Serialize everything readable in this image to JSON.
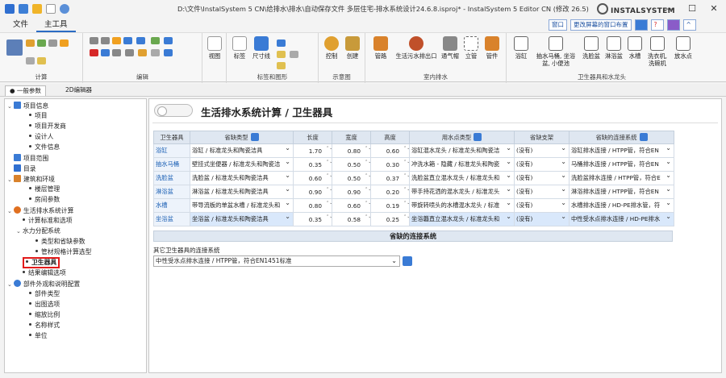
{
  "window": {
    "title": "D:\\文件\\InstalSystem 5 CN\\给排水\\排水\\自动保存文件 多层住宅-排水系统设计24.6.8.isproj* - InstalSystem 5 Editor CN (修改 26.5)",
    "logo": "INSTALSYSTEM",
    "controls": [
      "—",
      "☐",
      "✕"
    ]
  },
  "menu": {
    "file": "文件",
    "main_tool": "主工具"
  },
  "topright": {
    "window_label": "窗口",
    "layout_label": "更改屏幕的窗口布置"
  },
  "ribbon": {
    "groups": {
      "calc": "计算",
      "edit": "编辑",
      "labels": "标签和图形",
      "diagram": "示意图",
      "indoor": "室内排水",
      "fixtures": "卫生器具和水龙头"
    },
    "buttons": {
      "view": "视图",
      "label": "标签",
      "dimline": "尺寸线",
      "control": "控制",
      "create": "创建",
      "pipe": "管路",
      "outlet": "生活污水排出口",
      "vent": "通气帽",
      "stack": "立管",
      "fitting": "管件",
      "basin": "浴缸",
      "wc": "抽水马桶, 坐浴盆, 小便池",
      "washbasin": "洗脸盆",
      "showertray": "淋浴盆",
      "sink": "水槽",
      "washer": "洗衣机, 洗碗机",
      "floordrain": "放水点"
    }
  },
  "tabs": [
    {
      "label": "● 一般参数"
    },
    {
      "label": "2D编辑器"
    }
  ],
  "tree": {
    "items": [
      {
        "label": "项目信息"
      },
      {
        "label": "项目"
      },
      {
        "label": "项目开发商"
      },
      {
        "label": "设计人"
      },
      {
        "label": "文件信息"
      },
      {
        "label": "项目范围"
      },
      {
        "label": "目录"
      },
      {
        "label": "建筑和环境"
      },
      {
        "label": "楼层管理"
      },
      {
        "label": "房间参数"
      },
      {
        "label": "生活排水系统计算"
      },
      {
        "label": "计算标准和选项"
      },
      {
        "label": "水力分配系统"
      },
      {
        "label": "类型和省缺参数"
      },
      {
        "label": "管材规格计算选型"
      },
      {
        "label": "卫生器具"
      },
      {
        "label": "结果编辑选项"
      },
      {
        "label": "部件外观和说明配置"
      },
      {
        "label": "部件类型"
      },
      {
        "label": "出图选项"
      },
      {
        "label": "缩放比例"
      },
      {
        "label": "名称样式"
      },
      {
        "label": "单位"
      }
    ]
  },
  "main": {
    "title": "生活排水系统计算 / 卫生器具",
    "columns": [
      "卫生器具",
      "省缺类型",
      "长度",
      "宽度",
      "高度",
      "用水点类型",
      "省缺支架",
      "省缺的连接系统"
    ],
    "rows": [
      {
        "fixture": "浴缸",
        "type": "浴缸 / 标准龙头和陶瓷洁具",
        "length": "1.70",
        "width": "0.80",
        "height": "0.60",
        "point": "浴缸混水龙头 / 标准龙头和陶瓷洁",
        "support": "(没有)",
        "connection": "浴缸排水连接 / HTPP管，符合EN"
      },
      {
        "fixture": "抽水马桶",
        "type": "壁挂式坐便器 / 标准龙头和陶瓷洁",
        "length": "0.35",
        "width": "0.50",
        "height": "0.30",
        "point": "冲洗水箱 - 隐藏 / 标准龙头和陶瓷",
        "support": "(没有)",
        "connection": "马桶排水连接 / HTPP管，符合EN"
      },
      {
        "fixture": "洗脸盆",
        "type": "洗脸盆 / 标准龙头和陶瓷洁具",
        "length": "0.60",
        "width": "0.50",
        "height": "0.37",
        "point": "洗脸盆直立混水龙头 / 标准龙头和",
        "support": "(没有)",
        "connection": "洗脸盆排水连接 / HTPP管，符合E"
      },
      {
        "fixture": "淋浴盆",
        "type": "淋浴盆 / 标准龙头和陶瓷洁具",
        "length": "0.90",
        "width": "0.90",
        "height": "0.20",
        "point": "带手持花洒的混水龙头 / 标准龙头",
        "support": "(没有)",
        "connection": "淋浴排水连接 / HTPP管，符合EN"
      },
      {
        "fixture": "水槽",
        "type": "带导流板的单盆水槽 / 标准龙头和",
        "length": "0.80",
        "width": "0.60",
        "height": "0.19",
        "point": "带旋转喷头的水槽混水龙头 / 标准",
        "support": "(没有)",
        "connection": "水槽排水连接 / HD-PE排水管，符"
      },
      {
        "fixture": "坐浴盆",
        "type": "坐浴盆 / 标准龙头和陶瓷洁具",
        "length": "0.35",
        "width": "0.58",
        "height": "0.25",
        "point": "坐浴龘直立混水龙头 / 标准龙头和",
        "support": "(没有)",
        "connection": "中性受水点排水连接 / HD-PE排水"
      }
    ],
    "section_title": "省缺的连接系统",
    "other_label": "其它卫生器具的连接系统",
    "other_value": "中性受水点排水连接 / HTPP管，符合EN1451标准"
  },
  "colors": {
    "accent": "#2b6cc4",
    "highlight": "#e21b1b",
    "header_bg": "#dfe7f1"
  }
}
